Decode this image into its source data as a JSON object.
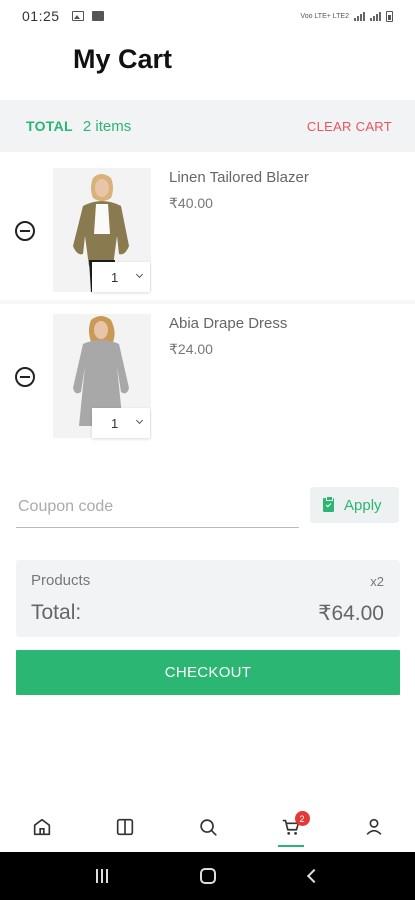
{
  "status_bar": {
    "time": "01:25",
    "network_label": "Voo LTE+ LTE2"
  },
  "header": {
    "title": "My Cart"
  },
  "totals_bar": {
    "label": "TOTAL",
    "count": "2 items",
    "clear_label": "CLEAR CART"
  },
  "cart": {
    "items": [
      {
        "name": "Linen Tailored Blazer",
        "price": "₹40.00",
        "quantity": "1"
      },
      {
        "name": "Abia Drape Dress",
        "price": "₹24.00",
        "quantity": "1"
      }
    ]
  },
  "coupon": {
    "placeholder": "Coupon code",
    "apply_label": "Apply"
  },
  "summary": {
    "products_label": "Products",
    "products_count": "x2",
    "total_label": "Total:",
    "total_value": "₹64.00"
  },
  "checkout": {
    "label": "CHECKOUT"
  },
  "bottom_nav": {
    "items": [
      {
        "icon": "home-icon"
      },
      {
        "icon": "categories-icon"
      },
      {
        "icon": "search-icon"
      },
      {
        "icon": "cart-icon",
        "badge": "2",
        "active": true
      },
      {
        "icon": "profile-icon"
      }
    ]
  },
  "colors": {
    "accent": "#2bb673",
    "danger": "#e9545d",
    "badge": "#e53935",
    "panel": "#f1f3f5"
  }
}
